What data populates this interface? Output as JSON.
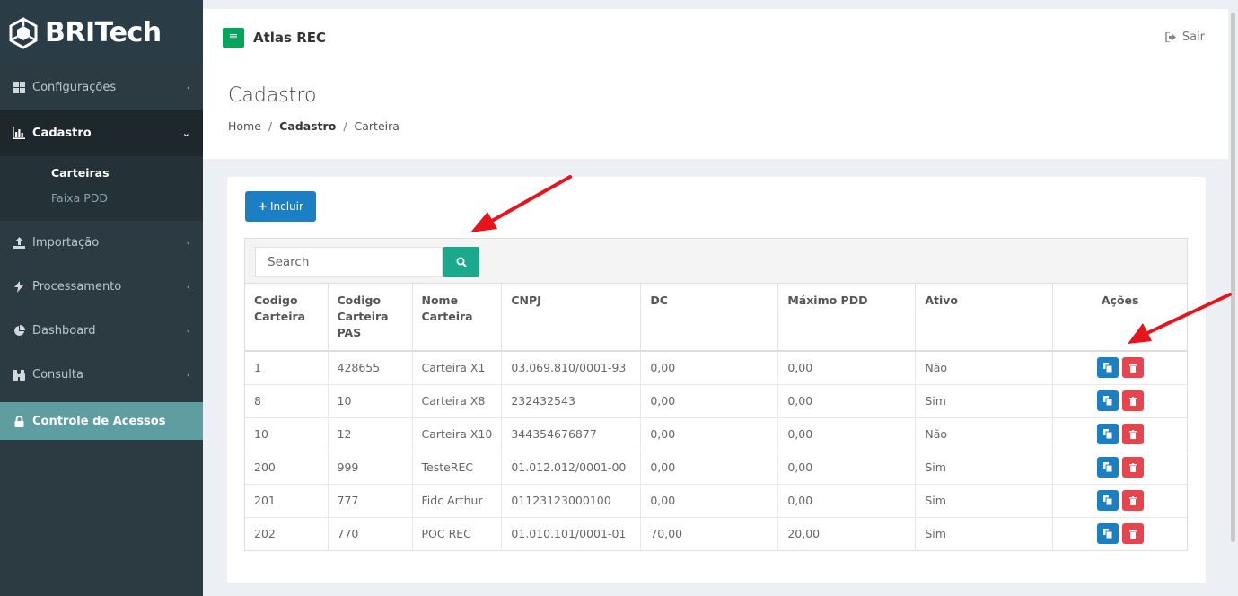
{
  "brand": {
    "name": "BRITech"
  },
  "sidebar": {
    "items": [
      {
        "label": "Configurações",
        "icon": "grid-icon"
      },
      {
        "label": "Cadastro",
        "icon": "bar-chart-icon",
        "active": true
      },
      {
        "label": "Importação",
        "icon": "upload-icon"
      },
      {
        "label": "Processamento",
        "icon": "bolt-icon"
      },
      {
        "label": "Dashboard",
        "icon": "pie-chart-icon"
      },
      {
        "label": "Consulta",
        "icon": "binoculars-icon"
      },
      {
        "label": "Controle de Acessos",
        "icon": "lock-icon"
      }
    ],
    "submenu": [
      {
        "label": "Carteiras",
        "current": true
      },
      {
        "label": "Faixa PDD"
      }
    ]
  },
  "topbar": {
    "title": "Atlas REC",
    "logout": "Sair"
  },
  "page": {
    "title": "Cadastro",
    "breadcrumb": [
      "Home",
      "Cadastro",
      "Carteira"
    ]
  },
  "toolbar": {
    "add_label": "Incluir"
  },
  "search": {
    "placeholder": "Search"
  },
  "table": {
    "headers": [
      [
        "Codigo",
        "Carteira"
      ],
      [
        "Codigo",
        "Carteira",
        "PAS"
      ],
      [
        "Nome",
        "Carteira"
      ],
      [
        "CNPJ"
      ],
      [
        "DC"
      ],
      [
        "Máximo PDD"
      ],
      [
        "Ativo"
      ],
      [
        "Ações"
      ]
    ],
    "rows": [
      [
        "1",
        "428655",
        "Carteira X1",
        "03.069.810/0001-93",
        "0,00",
        "0,00",
        "Não"
      ],
      [
        "8",
        "10",
        "Carteira X8",
        "232432543",
        "0,00",
        "0,00",
        "Sim"
      ],
      [
        "10",
        "12",
        "Carteira X10",
        "344354676877",
        "0,00",
        "0,00",
        "Não"
      ],
      [
        "200",
        "999",
        "TesteREC",
        "01.012.012/0001-00",
        "0,00",
        "0,00",
        "Sim"
      ],
      [
        "201",
        "777",
        "Fidc Arthur",
        "01123123000100",
        "0,00",
        "0,00",
        "Sim"
      ],
      [
        "202",
        "770",
        "POC REC",
        "01.010.101/0001-01",
        "70,00",
        "20,00",
        "Sim"
      ]
    ]
  },
  "colors": {
    "sidebar": "#2c3b41",
    "primary": "#1b7fc4",
    "success": "#1ba98c",
    "danger": "#e8444e",
    "annotation": "#e8141c"
  }
}
